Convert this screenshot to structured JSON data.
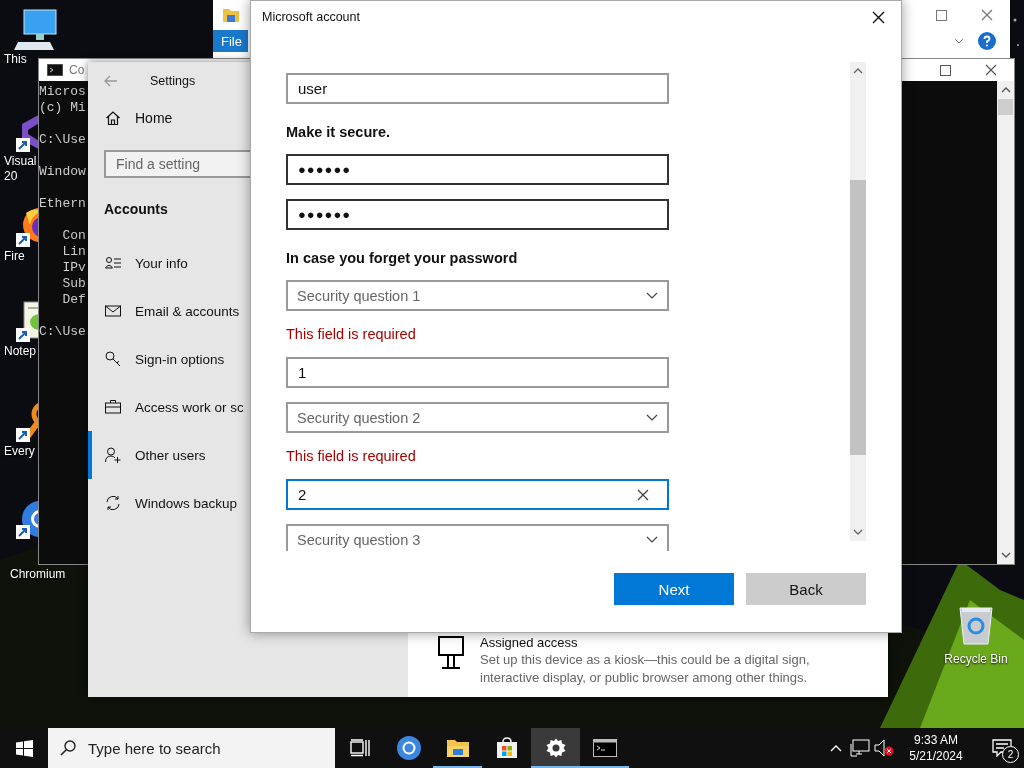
{
  "desktop_icons": [
    {
      "lines": [
        "This"
      ]
    },
    {
      "lines": [
        "Visual",
        "20"
      ]
    },
    {
      "lines": [
        "Fire"
      ]
    },
    {
      "lines": [
        "Notep"
      ]
    },
    {
      "lines": [
        "Every"
      ]
    },
    {
      "lines": [
        "Chromium"
      ]
    }
  ],
  "recycle_bin": {
    "label": "Recycle Bin"
  },
  "explorer_window": {
    "ribbon_tab": "File"
  },
  "console_window": {
    "title": "Co",
    "blocks": [
      [
        "Micros",
        "(c) Mi"
      ],
      [
        "C:\\Use"
      ],
      [
        "Window"
      ],
      [
        "Ethern"
      ],
      [
        "   Con",
        "   Lin",
        "   IPv",
        "   Sub",
        "   Def"
      ],
      [
        "C:\\Use"
      ]
    ]
  },
  "settings_window": {
    "title": "Settings",
    "home": "Home",
    "search": {
      "placeholder": "Find a setting"
    },
    "section": "Accounts",
    "nav": [
      {
        "label": "Your info",
        "selected": false
      },
      {
        "label": "Email & accounts",
        "selected": false
      },
      {
        "label": "Sign-in options",
        "selected": false
      },
      {
        "label": "Access work or sc",
        "selected": false
      },
      {
        "label": "Other users",
        "selected": true
      },
      {
        "label": "Windows backup",
        "selected": false
      }
    ],
    "assigned_access": {
      "title": "Assigned access",
      "description": "Set up this device as a kiosk—this could be a digital sign, interactive display, or public browser among other things."
    }
  },
  "dialog": {
    "title": "Microsoft account",
    "items": [
      {
        "kind": "text",
        "value": "user",
        "focused": false
      },
      {
        "kind": "heading",
        "text": "Make it secure."
      },
      {
        "kind": "password",
        "value": "●●●●●●",
        "focused": false
      },
      {
        "kind": "password",
        "value": "●●●●●●",
        "focused": false
      },
      {
        "kind": "heading",
        "text": "In case you forget your password"
      },
      {
        "kind": "select",
        "placeholder": "Security question 1"
      },
      {
        "kind": "error",
        "text": "This field is required"
      },
      {
        "kind": "text",
        "value": "1",
        "focused": false
      },
      {
        "kind": "select",
        "placeholder": "Security question 2"
      },
      {
        "kind": "error",
        "text": "This field is required"
      },
      {
        "kind": "text",
        "value": "2",
        "focused": true
      },
      {
        "kind": "select",
        "placeholder": "Security question 3"
      }
    ],
    "buttons": [
      {
        "label": "Next",
        "kind": "primary"
      },
      {
        "label": "Back",
        "kind": "secondary"
      }
    ]
  },
  "taskbar": {
    "search": {
      "placeholder": "Type here to search"
    },
    "apps": [
      {
        "kind": "task-view",
        "running": false,
        "selected": false
      },
      {
        "kind": "browser",
        "running": false,
        "selected": false
      },
      {
        "kind": "files",
        "running": true,
        "selected": false
      },
      {
        "kind": "store",
        "running": false,
        "selected": false
      },
      {
        "kind": "settings",
        "running": true,
        "selected": true
      },
      {
        "kind": "console",
        "running": true,
        "selected": false
      }
    ],
    "clock": {
      "time": "9:33 AM",
      "date": "5/21/2024"
    },
    "notifications": "2"
  }
}
